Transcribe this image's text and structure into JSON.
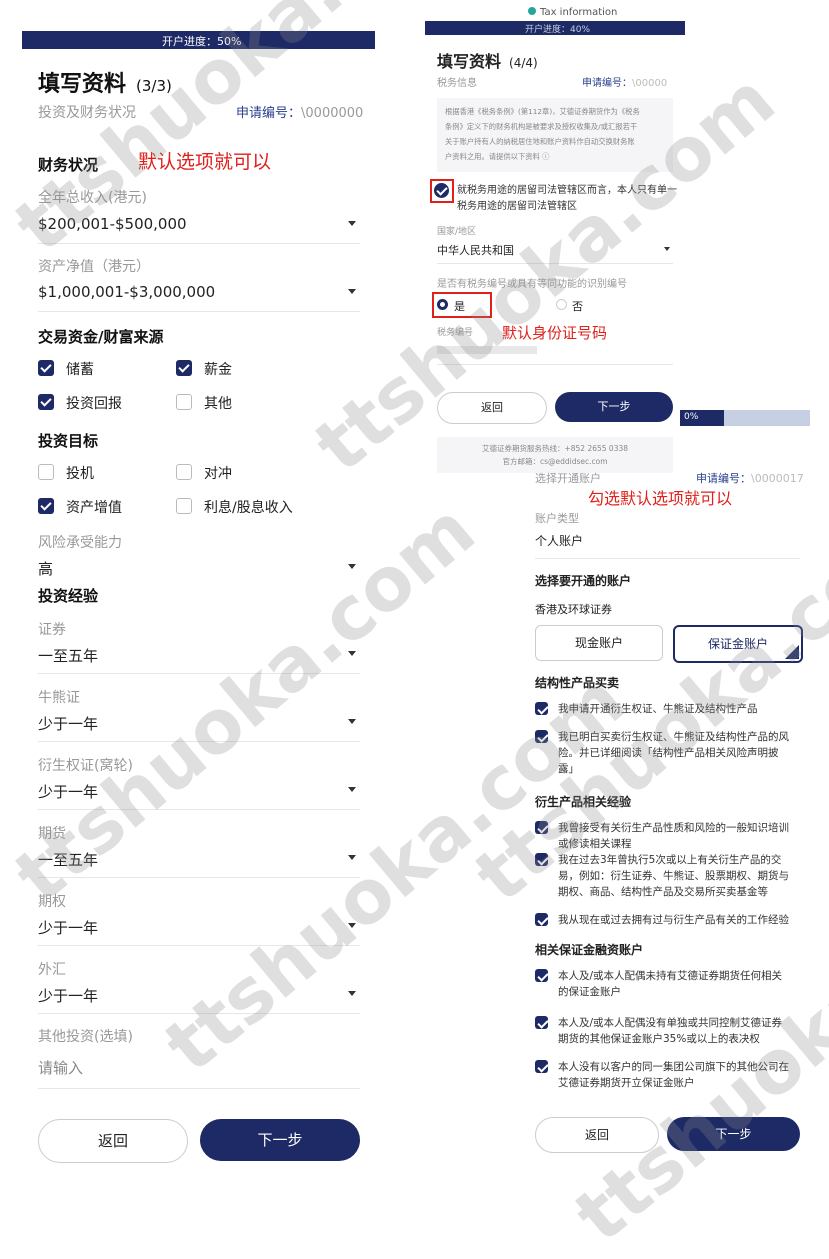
{
  "left": {
    "progress": "开户进度：50%",
    "title": "填写资料",
    "step": "(3/3)",
    "subtitle": "投资及财务状况",
    "app_no_label": "申请编号：",
    "app_no_value": "\\0000000",
    "fin_status": "财务状况",
    "annotation": "默认选项就可以",
    "income_label": "全年总收入(港元)",
    "income_value": "$200,001-$500,000",
    "assets_label": "资产净值（港元）",
    "assets_value": "$1,000,001-$3,000,000",
    "funds_section": "交易资金/财富来源",
    "funds": [
      {
        "label": "储蓄",
        "checked": true
      },
      {
        "label": "薪金",
        "checked": true
      },
      {
        "label": "投资回报",
        "checked": true
      },
      {
        "label": "其他",
        "checked": false
      }
    ],
    "goal_section": "投资目标",
    "goals": [
      {
        "label": "投机",
        "checked": false
      },
      {
        "label": "对冲",
        "checked": false
      },
      {
        "label": "资产增值",
        "checked": true
      },
      {
        "label": "利息/股息收入",
        "checked": false
      }
    ],
    "risk_label": "风险承受能力",
    "risk_value": "高",
    "exp_section": "投资经验",
    "exp": [
      {
        "label": "证券",
        "value": "一至五年"
      },
      {
        "label": "牛熊证",
        "value": "少于一年"
      },
      {
        "label": "衍生权证(窝轮)",
        "value": "少于一年"
      },
      {
        "label": "期货",
        "value": "一至五年"
      },
      {
        "label": "期权",
        "value": "少于一年"
      },
      {
        "label": "外汇",
        "value": "少于一年"
      }
    ],
    "other_label": "其他投资(选填)",
    "other_placeholder": "请输入",
    "back": "返回",
    "next": "下一步"
  },
  "tax": {
    "header": "Tax information",
    "progress": "开户进度：40%",
    "title": "填写资料",
    "step": "(4/4)",
    "subtitle": "税务信息",
    "app_no_label": "申请编号：",
    "app_no_value": "\\00000",
    "notice_lines": [
      "根据香港《税务条例》(第112章)，艾德证券期货作为《税务",
      "条例》定义下的财务机构是被要求及授权收集及/或汇报若干",
      "关于账户持有人的纳税居住地和账户资料作自动交换财务账",
      "户资料之用。请提供以下资料  ⓘ"
    ],
    "single_line1": "就税务用途的居留司法管辖区而言，本人只有单一",
    "single_line2": "税务用途的居留司法管辖区",
    "country_label": "国家/地区",
    "country_value": "中华人民共和国",
    "tin_question": "是否有税务编号或具有等同功能的识别编号",
    "yes": "是",
    "no": "否",
    "tin_label": "税务编号",
    "annotation": "默认身份证号码",
    "back": "返回",
    "next": "下一步",
    "hotline": "艾德证券期货服务热线：+852 2655 0338",
    "email": "官方邮箱：cs@eddidsec.com"
  },
  "acct": {
    "progress": "0%",
    "app_no_label": "申请编号：",
    "app_no_value": "\\0000017",
    "choose": "选择开通账户",
    "annotation": "勾选默认选项就可以",
    "type_label": "账户类型",
    "type_value": "个人账户",
    "open_section": "选择要开通的账户",
    "market": "香港及环球证券",
    "cash": "现金账户",
    "margin": "保证金账户",
    "struct_section": "结构性产品买卖",
    "struct": [
      [
        "我申请开通衍生权证、牛熊证及结构性产品"
      ],
      [
        "我已明白买卖衍生权证、牛熊证及结构性产品的风",
        "险。并已详细阅读「结构性产品相关风险声明披",
        "露」"
      ]
    ],
    "deriv_section": "衍生产品相关经验",
    "deriv": [
      [
        "我曾接受有关衍生产品性质和风险的一般知识培训",
        "或修读相关课程"
      ],
      [
        "我在过去3年曾执行5次或以上有关衍生产品的交",
        "易，例如：衍生证券、牛熊证、股票期权、期货与",
        "期权、商品、结构性产品及交易所买卖基金等"
      ],
      [
        "我从现在或过去拥有过与衍生产品有关的工作经验"
      ]
    ],
    "margin_section": "相关保证金融资账户",
    "margin_items": [
      [
        "本人及/或本人配偶未持有艾德证券期货任何相关",
        "的保证金账户"
      ],
      [
        "本人及/或本人配偶没有单独或共同控制艾德证券",
        "期货的其他保证金账户35%或以上的表决权"
      ],
      [
        "本人没有以客户的同一集团公司旗下的其他公司在",
        "艾德证券期货开立保证金账户"
      ]
    ],
    "back": "返回",
    "next": "下一步"
  },
  "watermark": "ttshuoka.com"
}
